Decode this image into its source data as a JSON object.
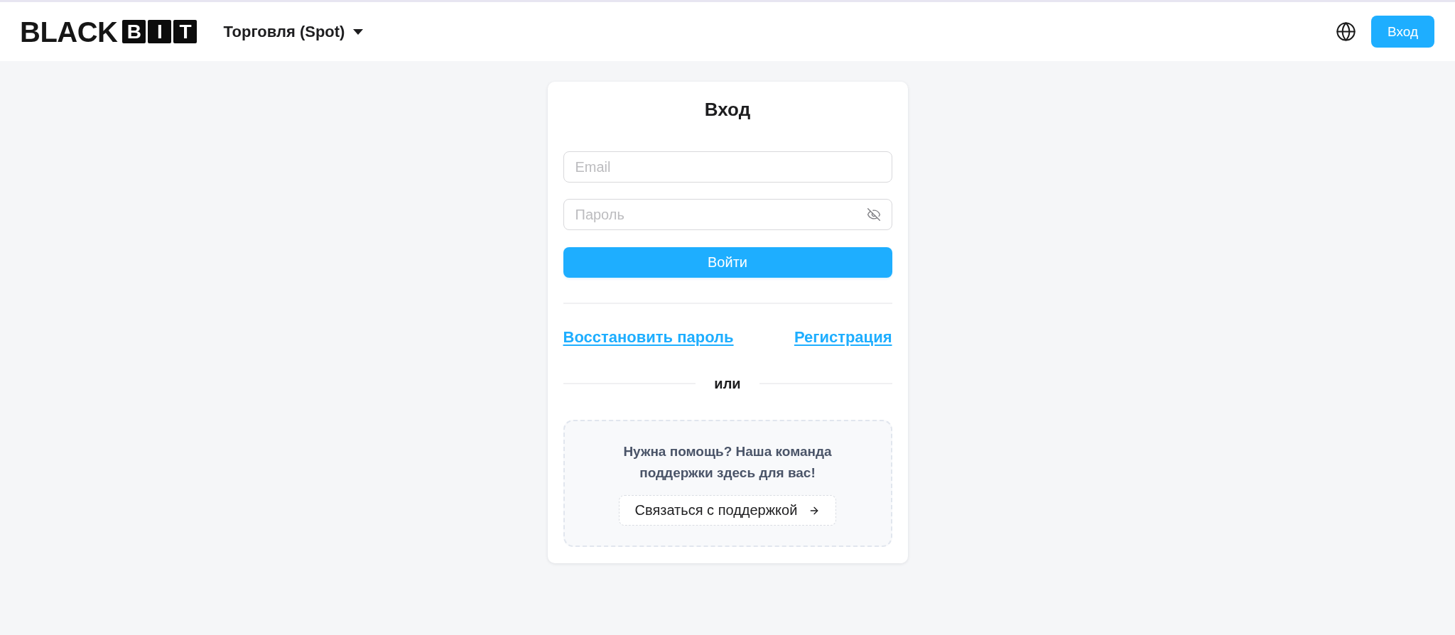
{
  "header": {
    "logo": {
      "wordmark": "BLACK",
      "tiles": [
        "B",
        "I",
        "T"
      ]
    },
    "market_menu": {
      "label": "Торговля (Spot)"
    },
    "login_button": "Вход"
  },
  "login_card": {
    "title": "Вход",
    "fields": [
      {
        "kind": "email",
        "placeholder": "Email"
      },
      {
        "kind": "password",
        "placeholder": "Пароль"
      }
    ],
    "submit_button": "Войти",
    "links": [
      "Восстановить пароль",
      "Регистрация"
    ],
    "separator": "или",
    "support": {
      "message": "Нужна помощь? Наша команда поддержки здесь для вас!",
      "button": "Связаться с поддержкой"
    }
  }
}
